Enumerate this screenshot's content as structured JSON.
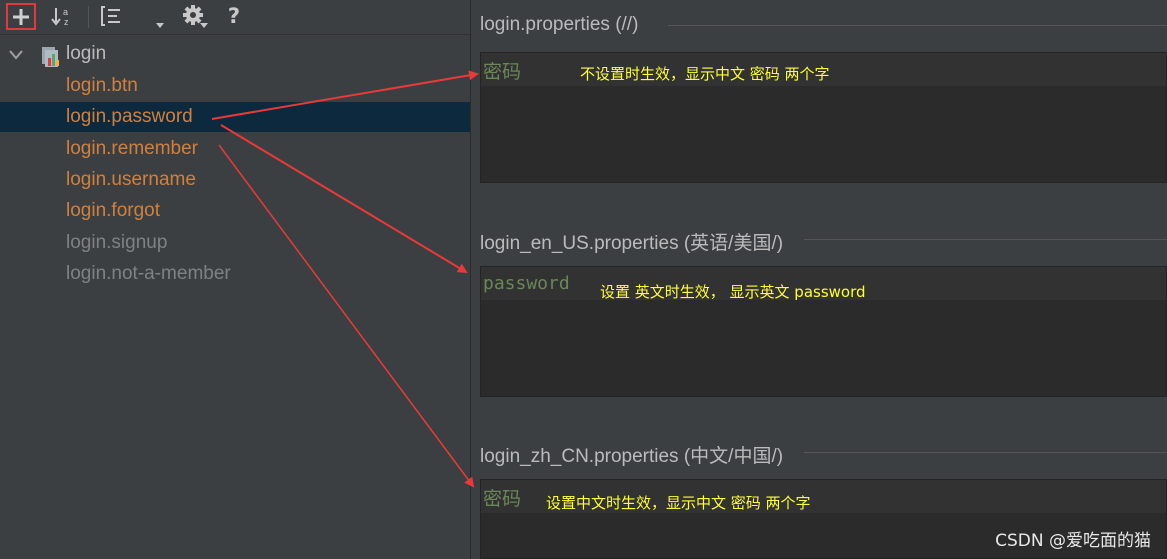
{
  "toolbar": {
    "add": "add-icon",
    "sort": "sort-alpha-icon",
    "group": "group-by-prefix-icon",
    "expand": "expand-dropdown-icon",
    "settings": "gear-icon",
    "help_label": "?"
  },
  "tree": {
    "root_label": "login",
    "keys": [
      {
        "label": "login.btn",
        "style": "orange"
      },
      {
        "label": "login.password",
        "style": "orange",
        "selected": true
      },
      {
        "label": "login.remember",
        "style": "orange"
      },
      {
        "label": "login.username",
        "style": "orange"
      },
      {
        "label": "login.forgot",
        "style": "orange"
      },
      {
        "label": "login.signup",
        "style": "gray"
      },
      {
        "label": "login.not-a-member",
        "style": "gray"
      }
    ]
  },
  "sections": [
    {
      "title": "login.properties (//)",
      "value": "密码",
      "note": "不设置时生效，显示中文 密码 两个字"
    },
    {
      "title": "login_en_US.properties (英语/美国/)",
      "value": "password",
      "note": "设置 英文时生效，  显示英文  password"
    },
    {
      "title": "login_zh_CN.properties (中文/中国/)",
      "value": "密码",
      "note": "设置中文时生效，显示中文 密码 两个字"
    }
  ],
  "watermark": "CSDN @爱吃面的猫",
  "colors": {
    "background": "#3c3f41",
    "selected_row": "#0d293e",
    "key_orange": "#d0803e",
    "key_gray": "#7e8285",
    "value_green": "#6a8759",
    "note_yellow": "#ffff33",
    "arrow_red": "#e8393b",
    "highlight_box": "#e0393e"
  }
}
